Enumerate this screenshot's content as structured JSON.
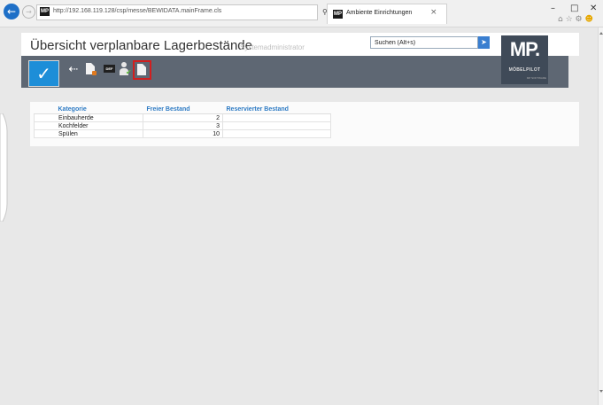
{
  "browser": {
    "url": "http://192.168.119.128/csp/messe/BEWIDATA.mainFrame.cls",
    "tab_title": "Ambiente Einrichtungen",
    "tab_close": "×",
    "favicon_text": "MP"
  },
  "header": {
    "title": "Übersicht verplanbare Lagerbestände",
    "user_role": "Systemadministrator",
    "search_value": "Suchen (Alt+s)"
  },
  "logo": {
    "mark": "MP.",
    "name": "MÖBELPILOT",
    "sub": "MP SOFTWARE",
    "bg_color": "#3f4a58"
  },
  "toolbar": {
    "confirm_glyph": "✓",
    "back_glyph": "⇠",
    "def_label": "DEF",
    "highlight_color": "#d21f1f"
  },
  "table": {
    "columns": [
      "Kategorie",
      "Freier Bestand",
      "Reservierter Bestand"
    ],
    "rows": [
      [
        "Einbauherde",
        "2",
        ""
      ],
      [
        "Kochfelder",
        "3",
        ""
      ],
      [
        "Spülen",
        "10",
        ""
      ]
    ]
  },
  "colors": {
    "toolbar_bg": "#5e6773",
    "accent_blue": "#1d8ed8",
    "header_link": "#2e7bc4"
  }
}
